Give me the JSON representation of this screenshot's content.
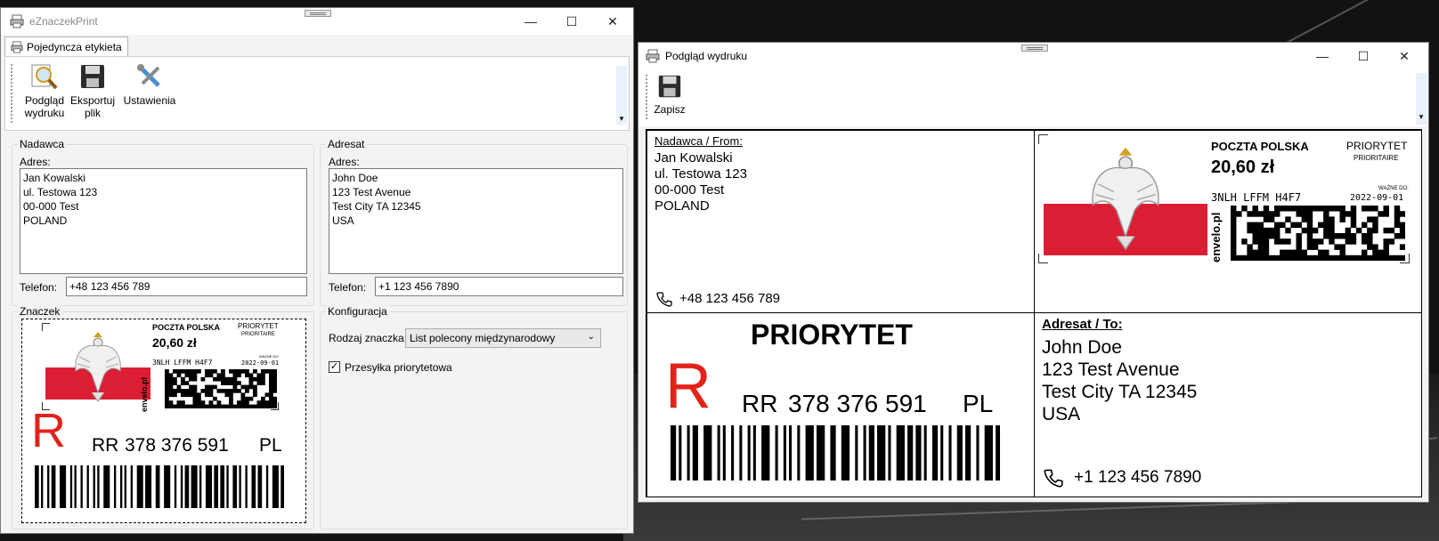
{
  "main_window": {
    "title": "eZnaczekPrint",
    "tab": "Pojedyncza etykieta",
    "toolbar": {
      "preview_line1": "Podgląd",
      "preview_line2": "wydruku",
      "export_line1": "Eksportuj",
      "export_line2": "plik",
      "settings": "Ustawienia"
    },
    "sender": {
      "group_title": "Nadawca",
      "address_label": "Adres:",
      "address": "Jan Kowalski\nul. Testowa 123\n00-000 Test\nPOLAND",
      "phone_label": "Telefon:",
      "phone": "+48 123 456 789"
    },
    "recipient": {
      "group_title": "Adresat",
      "address_label": "Adres:",
      "address": "John Doe\n123 Test Avenue\nTest City TA 12345\nUSA",
      "phone_label": "Telefon:",
      "phone": "+1 123 456 7890"
    },
    "stamp_group_title": "Znaczek",
    "config": {
      "group_title": "Konfiguracja",
      "stamp_type_label": "Rodzaj znaczka:",
      "stamp_type_value": "List polecony międzynarodowy",
      "priority_label": "Przesyłka priorytetowa",
      "priority_checked": true
    }
  },
  "preview_window": {
    "title": "Podgląd wydruku",
    "save_label": "Zapisz",
    "sender_heading": "Nadawca / From:",
    "sender_lines": [
      "Jan Kowalski",
      "ul. Testowa 123",
      "00-000 Test",
      "POLAND"
    ],
    "sender_phone": "+48 123 456 789",
    "recipient_heading": "Adresat / To:",
    "recipient_lines": [
      "John Doe",
      "123 Test Avenue",
      "Test City TA 12345",
      "USA"
    ],
    "recipient_phone": "+1 123 456 7890",
    "priority_big": "PRIORYTET"
  },
  "stamp": {
    "operator": "POCZTA POLSKA",
    "price": "20,60 zł",
    "priority_title": "PRIORYTET",
    "priority_sub": "PRIORITAIRE",
    "code": "3NLH LFFM H4F7",
    "valid_label": "WAŻNE DO:",
    "valid_date": "2022-09-01",
    "brand": "envelo.pl"
  },
  "registration": {
    "letter": "R",
    "prefix": "RR",
    "number": "378 376 591",
    "country": "PL"
  },
  "colors": {
    "flag_red": "#dc1e35",
    "reg_red": "#e2231a",
    "window_bg": "#f3f3f3"
  }
}
